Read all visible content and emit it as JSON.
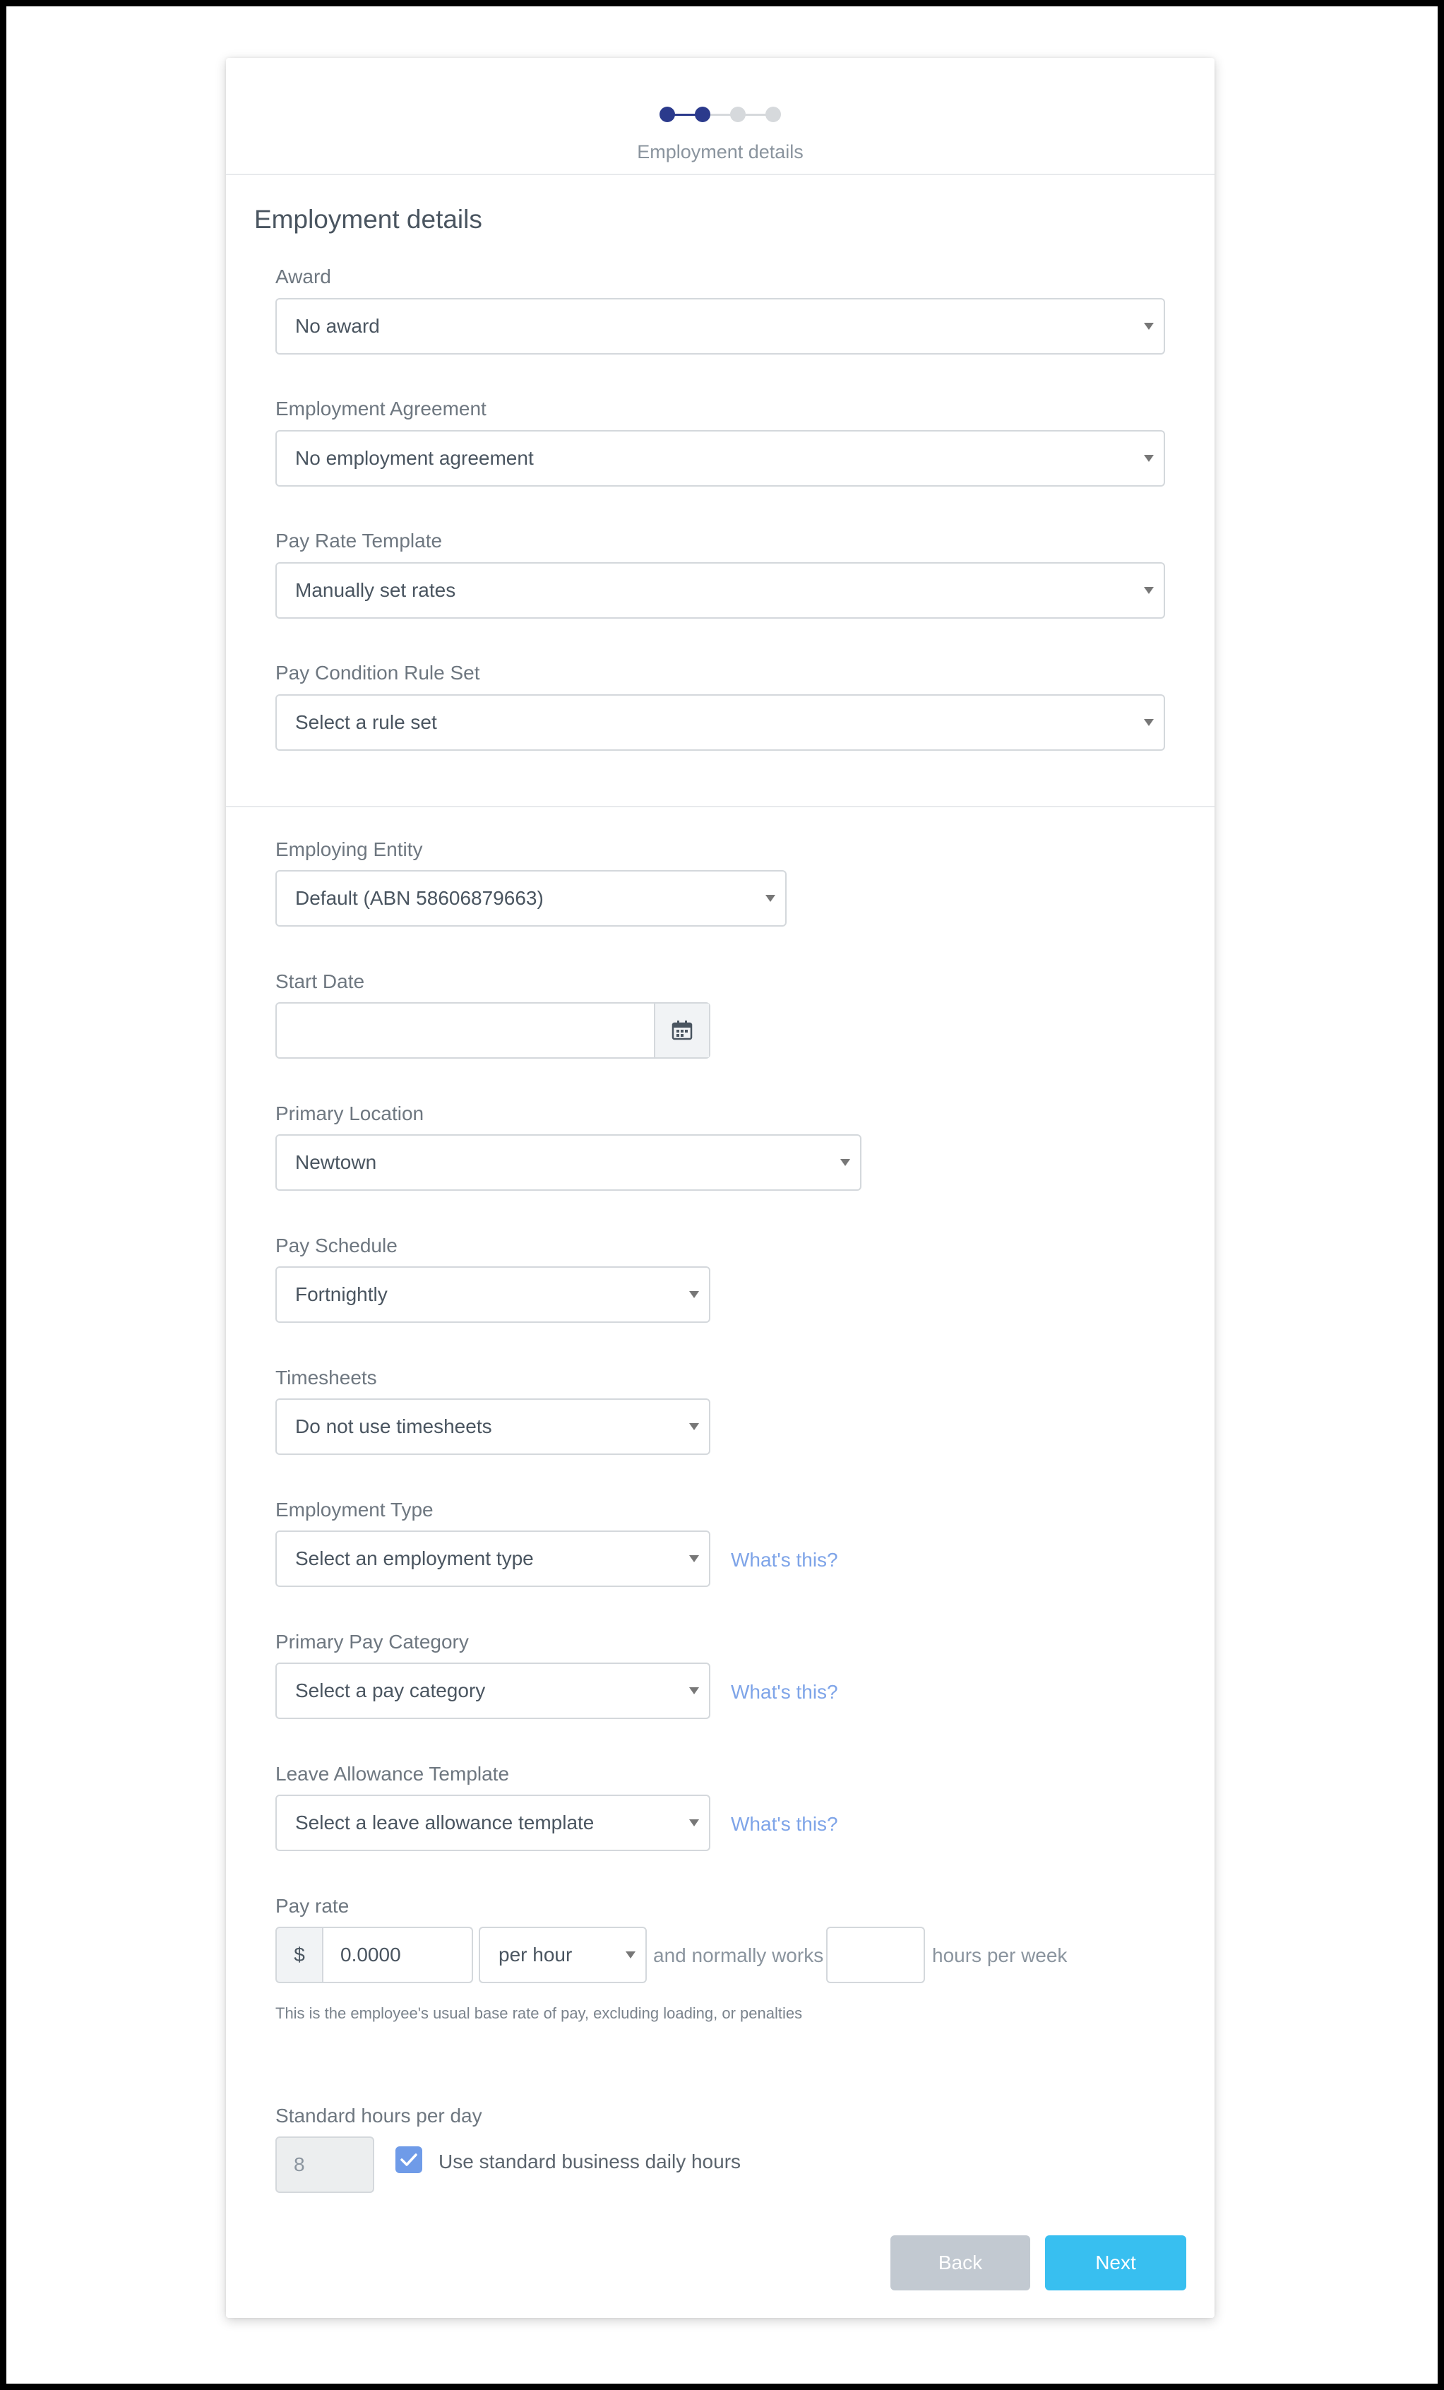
{
  "stepper": {
    "label": "Employment details",
    "steps_total": 4,
    "steps_done": 2
  },
  "section": {
    "title": "Employment details"
  },
  "fields": {
    "award": {
      "label": "Award",
      "value": "No award"
    },
    "agreement": {
      "label": "Employment Agreement",
      "value": "No employment agreement"
    },
    "pay_rate_template": {
      "label": "Pay Rate Template",
      "value": "Manually set rates"
    },
    "pay_condition": {
      "label": "Pay Condition Rule Set",
      "value": "Select a rule set"
    },
    "employing_entity": {
      "label": "Employing Entity",
      "value": "Default (ABN 58606879663)"
    },
    "start_date": {
      "label": "Start Date",
      "value": ""
    },
    "primary_location": {
      "label": "Primary Location",
      "value": "Newtown"
    },
    "pay_schedule": {
      "label": "Pay Schedule",
      "value": "Fortnightly"
    },
    "timesheets": {
      "label": "Timesheets",
      "value": "Do not use timesheets"
    },
    "employment_type": {
      "label": "Employment Type",
      "value": "Select an employment type",
      "help_link": "What's this?"
    },
    "primary_pay_category": {
      "label": "Primary Pay Category",
      "value": "Select a pay category",
      "help_link": "What's this?"
    },
    "leave_allowance": {
      "label": "Leave Allowance Template",
      "value": "Select a leave allowance template",
      "help_link": "What's this?"
    },
    "pay_rate": {
      "label": "Pay rate",
      "currency": "$",
      "amount": "0.0000",
      "unit": "per hour",
      "mid_text": "and normally works",
      "hours": "",
      "suffix": "hours per week",
      "help": "This is the employee's usual base rate of pay, excluding loading, or penalties"
    },
    "standard_hours": {
      "label": "Standard hours per day",
      "value": "8",
      "checkbox_label": "Use standard business daily hours",
      "checked": true
    }
  },
  "actions": {
    "back": "Back",
    "next": "Next"
  },
  "colors": {
    "accent": "#2b3a8c",
    "link": "#7ea4e8",
    "next": "#38bff0",
    "back": "#c2c9d1",
    "checkbox": "#6f9be8"
  }
}
